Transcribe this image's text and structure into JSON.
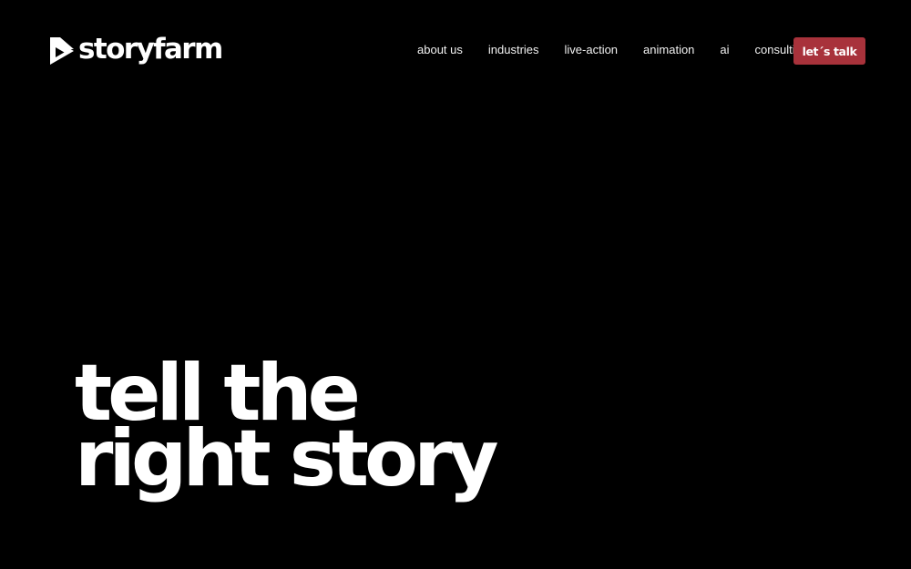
{
  "brand": {
    "name": "storyfarm",
    "logo_icon": "storyfarm-play-mark-icon"
  },
  "nav": {
    "items": [
      {
        "label": "about us"
      },
      {
        "label": "industries"
      },
      {
        "label": "live-action"
      },
      {
        "label": "animation"
      },
      {
        "label": "ai"
      },
      {
        "label": "consulting"
      }
    ],
    "cta_label": "let´s talk"
  },
  "hero": {
    "line1": "tell the",
    "line2": "right story"
  },
  "colors": {
    "background": "#000000",
    "text": "#ffffff",
    "accent": "#a8323b"
  }
}
